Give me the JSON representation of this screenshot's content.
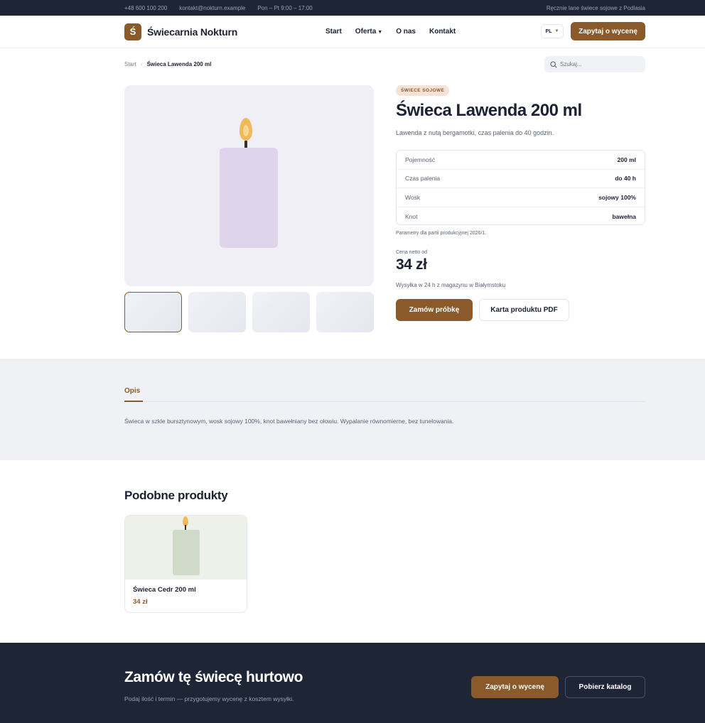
{
  "topbar": {
    "phone": "+48 600 100 200",
    "email": "kontakt@nokturn.example",
    "hours": "Pon – Pt 9:00 – 17:00",
    "tagline": "Ręcznie lane świece sojowe z Podlasia"
  },
  "header": {
    "logo_mark": "Ś",
    "brand": "Świecarnia Nokturn",
    "nav": [
      {
        "label": "Start"
      },
      {
        "label": "Oferta",
        "has_dropdown": true
      },
      {
        "label": "O nas"
      },
      {
        "label": "Kontakt"
      }
    ],
    "lang": "PL",
    "cta": "Zapytaj o wycenę"
  },
  "breadcrumb": {
    "home": "Start",
    "current": "Świeca Lawenda 200 ml"
  },
  "search": {
    "placeholder": "Szukaj..."
  },
  "product": {
    "badge": "ŚWIECE SOJOWE",
    "title": "Świeca Lawenda 200 ml",
    "subtitle": "Lawenda z nutą bergamotki, czas palenia do 40 godzin.",
    "specs": [
      {
        "key": "Pojemność",
        "value": "200 ml"
      },
      {
        "key": "Czas palenia",
        "value": "do 40 h"
      },
      {
        "key": "Wosk",
        "value": "sojowy 100%"
      },
      {
        "key": "Knot",
        "value": "bawełna"
      }
    ],
    "spec_note": "Parametry dla partii produkcyjnej 2026/1.",
    "price_label": "Cena netto od",
    "price": "34 zł",
    "shipping": "Wysyłka w 24 h z magazynu w Białymstoku",
    "btn_sample": "Zamów próbkę",
    "btn_pdf": "Karta produktu PDF",
    "candle_color": "#e0d4ec",
    "gallery_bg": "#f1eff6"
  },
  "description": {
    "tab": "Opis",
    "text": "Świeca w szkle bursztynowym, wosk sojowy 100%, knot bawełniany bez ołowiu. Wypalanie równomierne, bez tunelowania."
  },
  "related": {
    "title": "Podobne produkty",
    "items": [
      {
        "name": "Świeca Cedr 200 ml",
        "price": "34 zł"
      }
    ]
  },
  "cta": {
    "title": "Zamów tę świecę hurtowo",
    "subtitle": "Podaj ilość i termin — przygotujemy wycenę z kosztem wysyłki.",
    "btn_quote": "Zapytaj o wycenę",
    "btn_catalog": "Pobierz katalog"
  },
  "colors": {
    "accent": "#8a5a2b",
    "dark": "#1e2535",
    "text": "#1c2231"
  }
}
